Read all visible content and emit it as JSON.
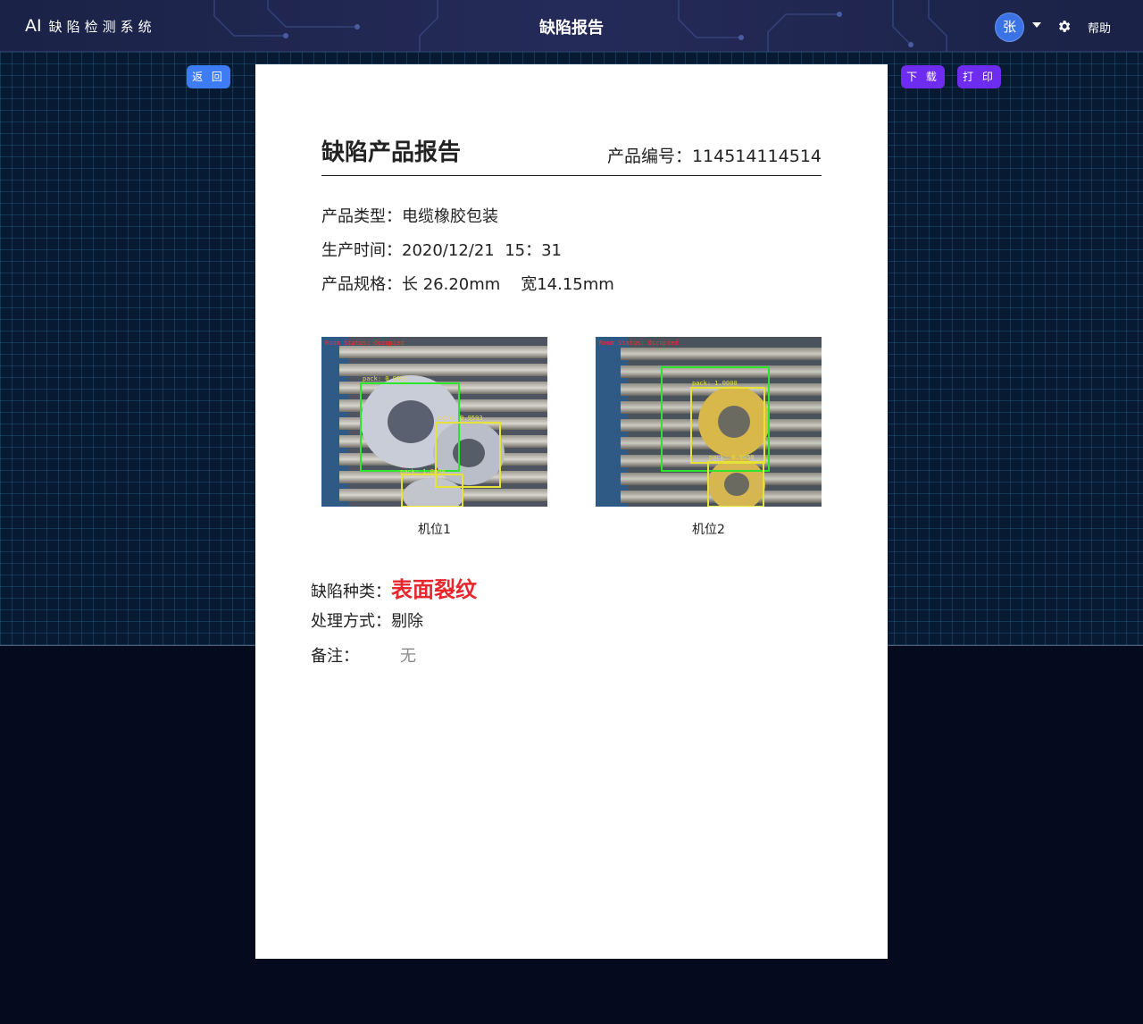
{
  "header": {
    "logo_ai": "AI",
    "logo_name": "缺陷检测系统",
    "title": "缺陷报告",
    "avatar_text": "张",
    "help_label": "帮助",
    "icons": [
      "chevron-down-icon",
      "gear-icon"
    ]
  },
  "toolbar": {
    "back_label": "返 回",
    "download_label": "下 载",
    "print_label": "打 印"
  },
  "report": {
    "title": "缺陷产品报告",
    "product_no": "产品编号：114514114514",
    "product_type": "产品类型：电缆橡胶包装",
    "production_time": "生产时间：2020/12/21  15：31",
    "spec": "产品规格：长 26.20mm    宽14.15mm",
    "images": [
      {
        "caption": "机位1",
        "status_text": "Room Status: Occupied",
        "detections": [
          "pack: 0.9998",
          "pack: 0.9593",
          "pack: 1.0000"
        ]
      },
      {
        "caption": "机位2",
        "status_text": "Room Status: Occupied",
        "detections": [
          "pack: 1.0000",
          "pack: 0.9950"
        ]
      }
    ],
    "defect_label": "缺陷种类：",
    "defect_value": "表面裂纹",
    "handling_label": "处理方式：",
    "handling_value": "剔除",
    "note_label": "备注：",
    "note_value": "无"
  },
  "colors": {
    "defect": "#e8262d",
    "back_button": "#3d7cf5",
    "action_button": "#6d2cf0",
    "avatar": "#3b73e6"
  }
}
